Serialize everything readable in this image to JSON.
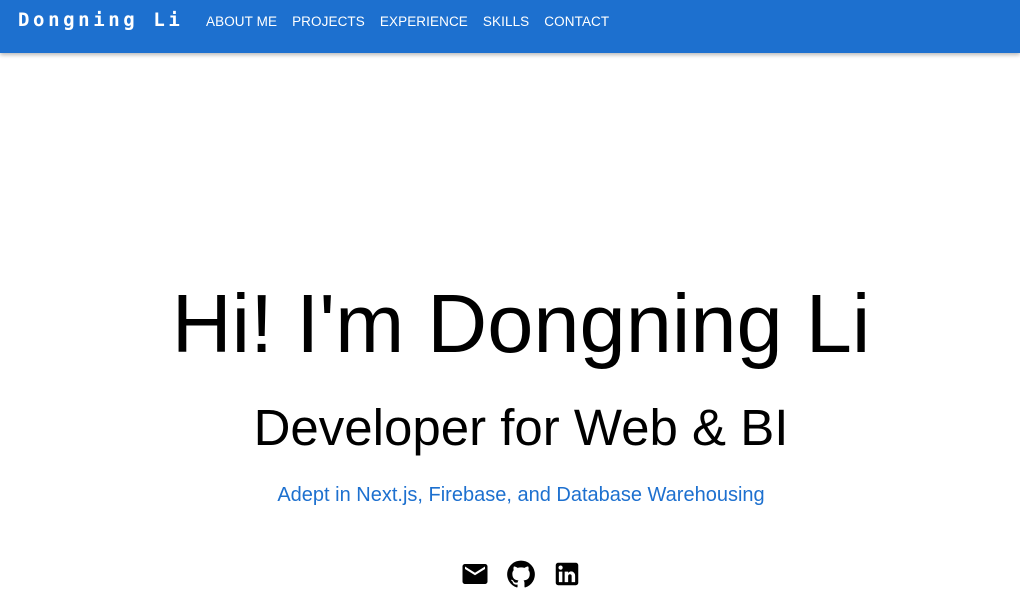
{
  "nav": {
    "brand": "Dongning Li",
    "links": [
      {
        "label": "ABOUT ME"
      },
      {
        "label": "PROJECTS"
      },
      {
        "label": "EXPERIENCE"
      },
      {
        "label": "SKILLS"
      },
      {
        "label": "CONTACT"
      }
    ]
  },
  "hero": {
    "title": "Hi! I'm Dongning Li",
    "subtitle": "Developer for Web & BI",
    "tagline": "Adept in Next.js, Firebase, and Database Warehousing"
  },
  "social": {
    "icons": [
      "email-icon",
      "github-icon",
      "linkedin-icon"
    ]
  },
  "colors": {
    "brand_blue": "#1d70cf",
    "text": "#000000",
    "background": "#ffffff"
  }
}
